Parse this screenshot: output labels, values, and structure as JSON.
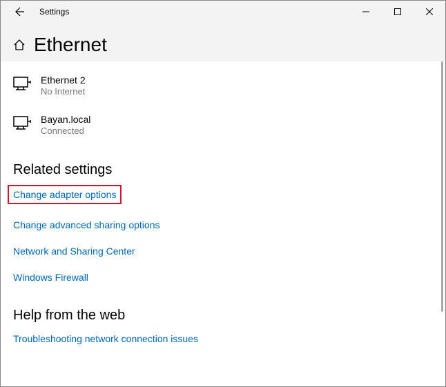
{
  "window": {
    "app": "Settings"
  },
  "page": {
    "title": "Ethernet"
  },
  "networks": [
    {
      "name": "Ethernet 2",
      "status": "No Internet"
    },
    {
      "name": "Bayan.local",
      "status": "Connected"
    }
  ],
  "related": {
    "heading": "Related settings",
    "links": [
      "Change adapter options",
      "Change advanced sharing options",
      "Network and Sharing Center",
      "Windows Firewall"
    ]
  },
  "help": {
    "heading": "Help from the web",
    "links": [
      "Troubleshooting network connection issues"
    ]
  }
}
